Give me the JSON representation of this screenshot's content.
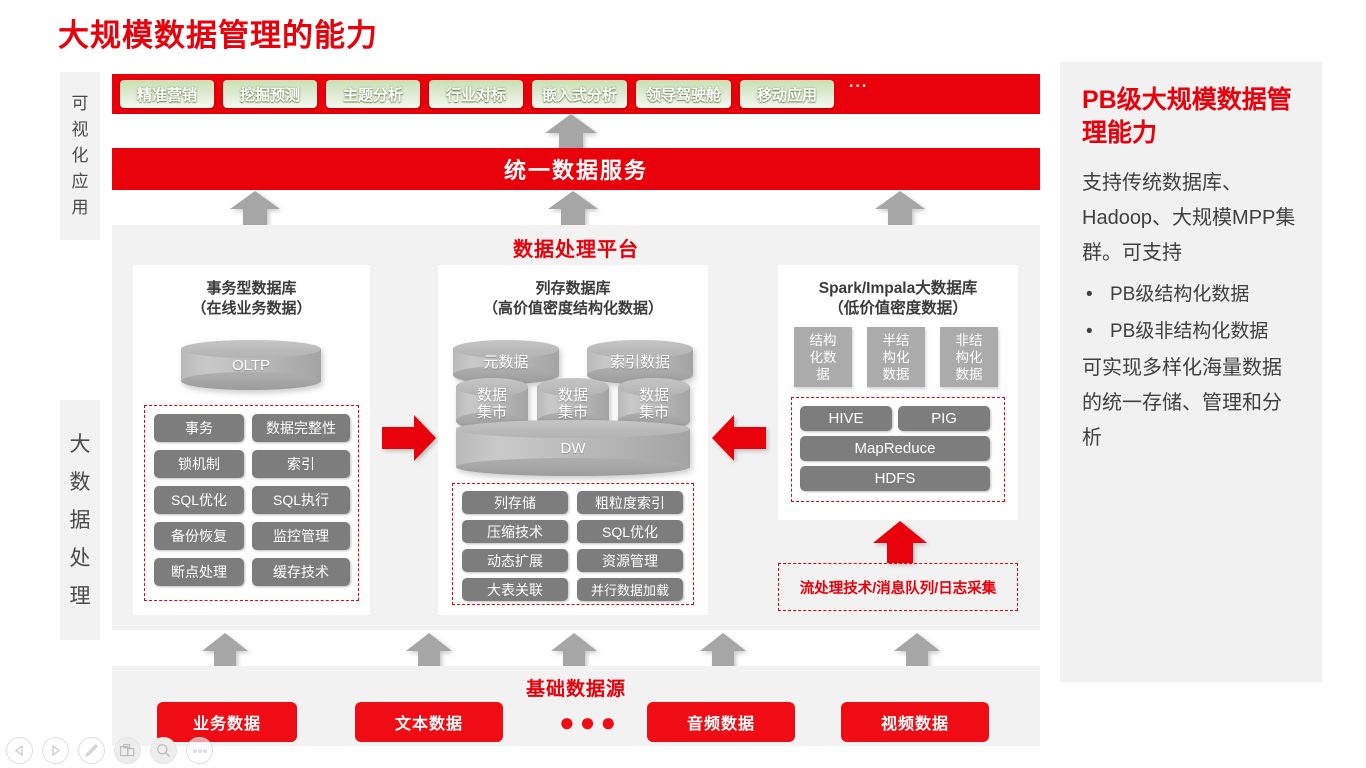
{
  "slide": {
    "title": "大规模数据管理的能力"
  },
  "layers": {
    "visualization_label": [
      "可",
      "视",
      "化",
      "应",
      "用"
    ],
    "processing_label": [
      "大",
      "数",
      "据",
      "处",
      "理"
    ]
  },
  "app_bar": {
    "chips": [
      "精准营销",
      "挖掘预测",
      "主题分析",
      "行业对标",
      "嵌入式分析",
      "领导驾驶舱",
      "移动应用"
    ],
    "overflow": "∙∙∙"
  },
  "unified_service": {
    "label": "统一数据服务"
  },
  "platform": {
    "title": "数据处理平台",
    "columns": [
      {
        "id": "oltp",
        "title_line1": "事务型数据库",
        "title_line2": "（在线业务数据）",
        "cylinder": "OLTP",
        "tags": [
          "事务",
          "数据完整性",
          "锁机制",
          "索引",
          "SQL优化",
          "SQL执行",
          "备份恢复",
          "监控管理",
          "断点处理",
          "缓存技术"
        ]
      },
      {
        "id": "columnar",
        "title_line1": "列存数据库",
        "title_line2": "（高价值密度结构化数据）",
        "cyl_top": [
          "元数据",
          "索引数据"
        ],
        "cyl_mid": [
          "数据\n集市",
          "数据\n集市",
          "数据\n集市"
        ],
        "cyl_base": "DW",
        "tags": [
          "列存储",
          "粗粒度索引",
          "压缩技术",
          "SQL优化",
          "动态扩展",
          "资源管理",
          "大表关联",
          "并行数据加载"
        ]
      },
      {
        "id": "bigdata",
        "title_line1": "Spark/Impala大数据库",
        "title_line2": "（低价值密度数据）",
        "data_types": [
          "结构\n化数\n据",
          "半结\n构化\n数据",
          "非结\n构化\n数据"
        ],
        "stack": [
          "HIVE",
          "PIG",
          "MapReduce",
          "HDFS"
        ],
        "stream_note": "流处理技术/消息队列/日志采集"
      }
    ]
  },
  "data_sources": {
    "title": "基础数据源",
    "items": [
      "业务数据",
      "文本数据",
      "音频数据",
      "视频数据"
    ],
    "ellipsis": "●●●"
  },
  "info_panel": {
    "title": "PB级大规模数据管理能力",
    "paragraph1": "支持传统数据库、Hadoop、大规模MPP集群。可支持",
    "bullets": [
      "PB级结构化数据",
      "PB级非结构化数据"
    ],
    "paragraph2": "可实现多样化海量数据的统一存储、管理和分析"
  },
  "toolbar": {
    "buttons": [
      "prev",
      "next",
      "pen",
      "layout",
      "zoom",
      "more"
    ]
  },
  "colors": {
    "brand_red": "#e8000b",
    "source_red": "#ef0c14",
    "tag_gray": "#7d7d7d",
    "box_gray": "#ababab",
    "panel_gray": "#f2f2f2",
    "arrow_gray": "#a6a6a6"
  }
}
